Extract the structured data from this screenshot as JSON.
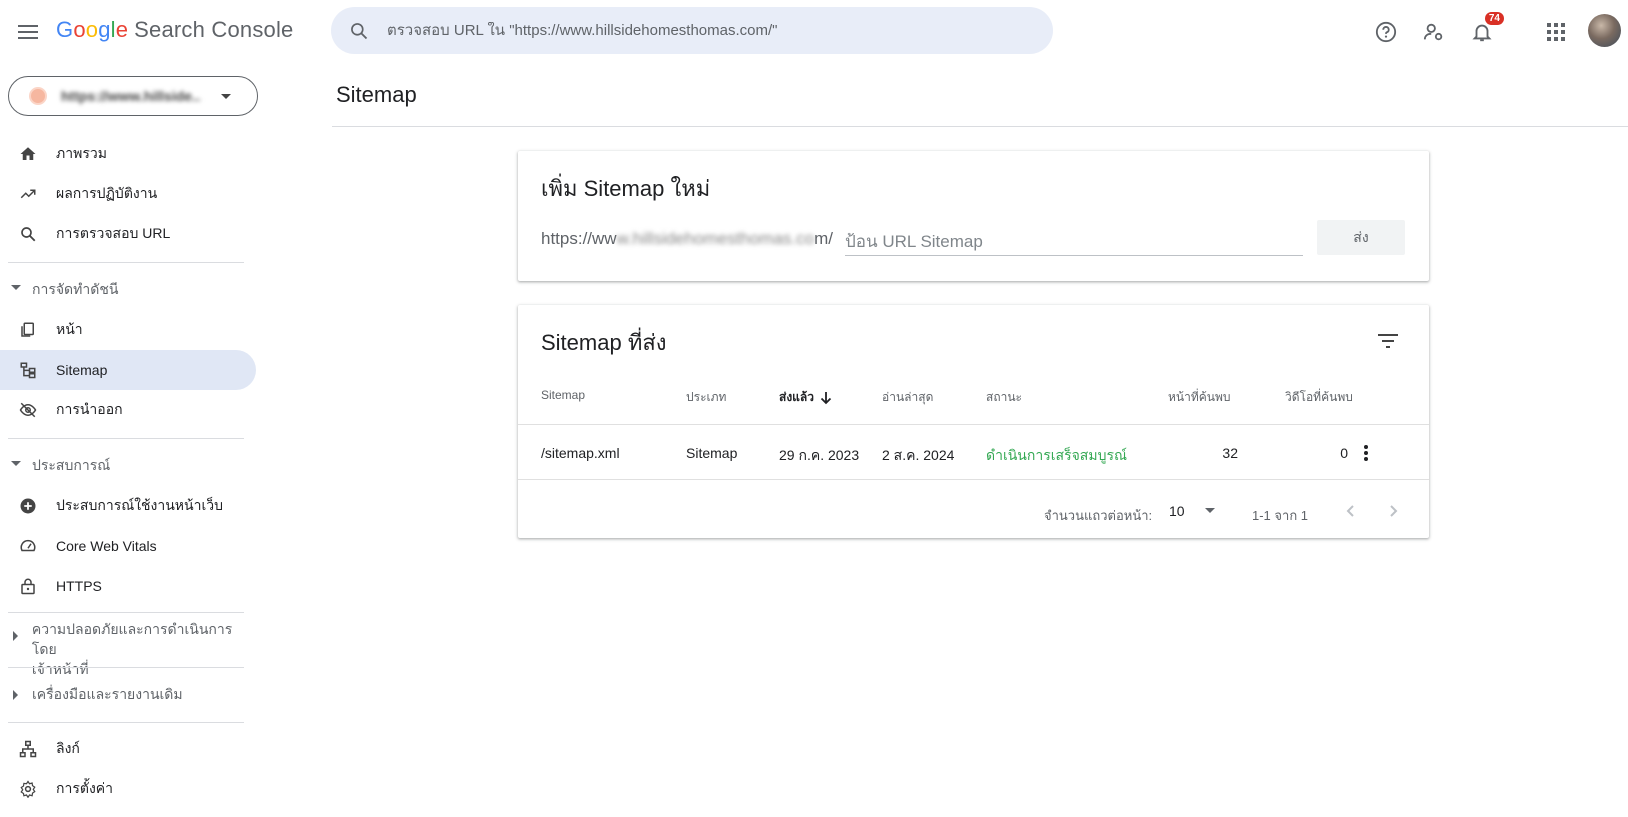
{
  "header": {
    "logo_letters": [
      "G",
      "o",
      "o",
      "g",
      "l",
      "e"
    ],
    "product_name": "Search Console",
    "search_placeholder": "ตรวจสอบ URL ใน \"https://www.hillsidehomesthomas.com/\"",
    "notification_count": "74"
  },
  "sidebar": {
    "property_label": "https://www.hillside...",
    "items": [
      {
        "label": "ภาพรวม",
        "icon": "home-icon"
      },
      {
        "label": "ผลการปฏิบัติงาน",
        "icon": "trending-up-icon"
      },
      {
        "label": "การตรวจสอบ URL",
        "icon": "search-icon"
      }
    ],
    "section_indexing": "การจัดทำดัชนี",
    "indexing_items": [
      {
        "label": "หน้า",
        "icon": "pages-icon"
      },
      {
        "label": "Sitemap",
        "icon": "sitemap-icon"
      },
      {
        "label": "การนำออก",
        "icon": "visibility-off-icon"
      }
    ],
    "section_experience": "ประสบการณ์",
    "experience_items": [
      {
        "label": "ประสบการณ์ใช้งานหน้าเว็บ",
        "icon": "add-circle-icon"
      },
      {
        "label": "Core Web Vitals",
        "icon": "speed-icon"
      },
      {
        "label": "HTTPS",
        "icon": "lock-icon"
      }
    ],
    "section_security": "ความปลอดภัยและการดำเนินการโดยเจ้าหน้าที่",
    "section_security_line1": "ความปลอดภัยและการดำเนินการโดย",
    "section_security_line2": "เจ้าหน้าที่",
    "section_legacy": "เครื่องมือและรายงานเดิม",
    "bottom_items": [
      {
        "label": "ลิงก์",
        "icon": "links-icon"
      },
      {
        "label": "การตั้งค่า",
        "icon": "settings-icon"
      }
    ]
  },
  "page": {
    "title": "Sitemap"
  },
  "add_card": {
    "title": "เพิ่ม Sitemap ใหม่",
    "url_start": "https://ww",
    "url_blurred": "w.hillsidehomesthomas.co",
    "url_end": "m/",
    "input_placeholder": "ป้อน URL Sitemap",
    "submit_label": "ส่ง"
  },
  "submitted_card": {
    "title": "Sitemap ที่ส่ง",
    "columns": {
      "sitemap": "Sitemap",
      "type": "ประเภท",
      "submitted": "ส่งแล้ว",
      "last_read": "อ่านล่าสุด",
      "status": "สถานะ",
      "pages_found": "หน้าที่ค้นพบ",
      "videos_found": "วิดีโอที่ค้นพบ"
    },
    "rows": [
      {
        "sitemap": "/sitemap.xml",
        "type": "Sitemap",
        "submitted": "29 ก.ค. 2023",
        "last_read": "2 ส.ค. 2024",
        "status": "ดำเนินการเสร็จสมบูรณ์",
        "pages_found": "32",
        "videos_found": "0"
      }
    ],
    "pagination": {
      "rows_per_page_label": "จำนวนแถวต่อหน้า:",
      "rows_per_page_value": "10",
      "range_text": "1-1 จาก 1"
    }
  },
  "colors": {
    "active_nav": "#e0e7f5",
    "search_bg": "#e8edf8",
    "status_success": "#34a853",
    "badge": "#d93025"
  }
}
